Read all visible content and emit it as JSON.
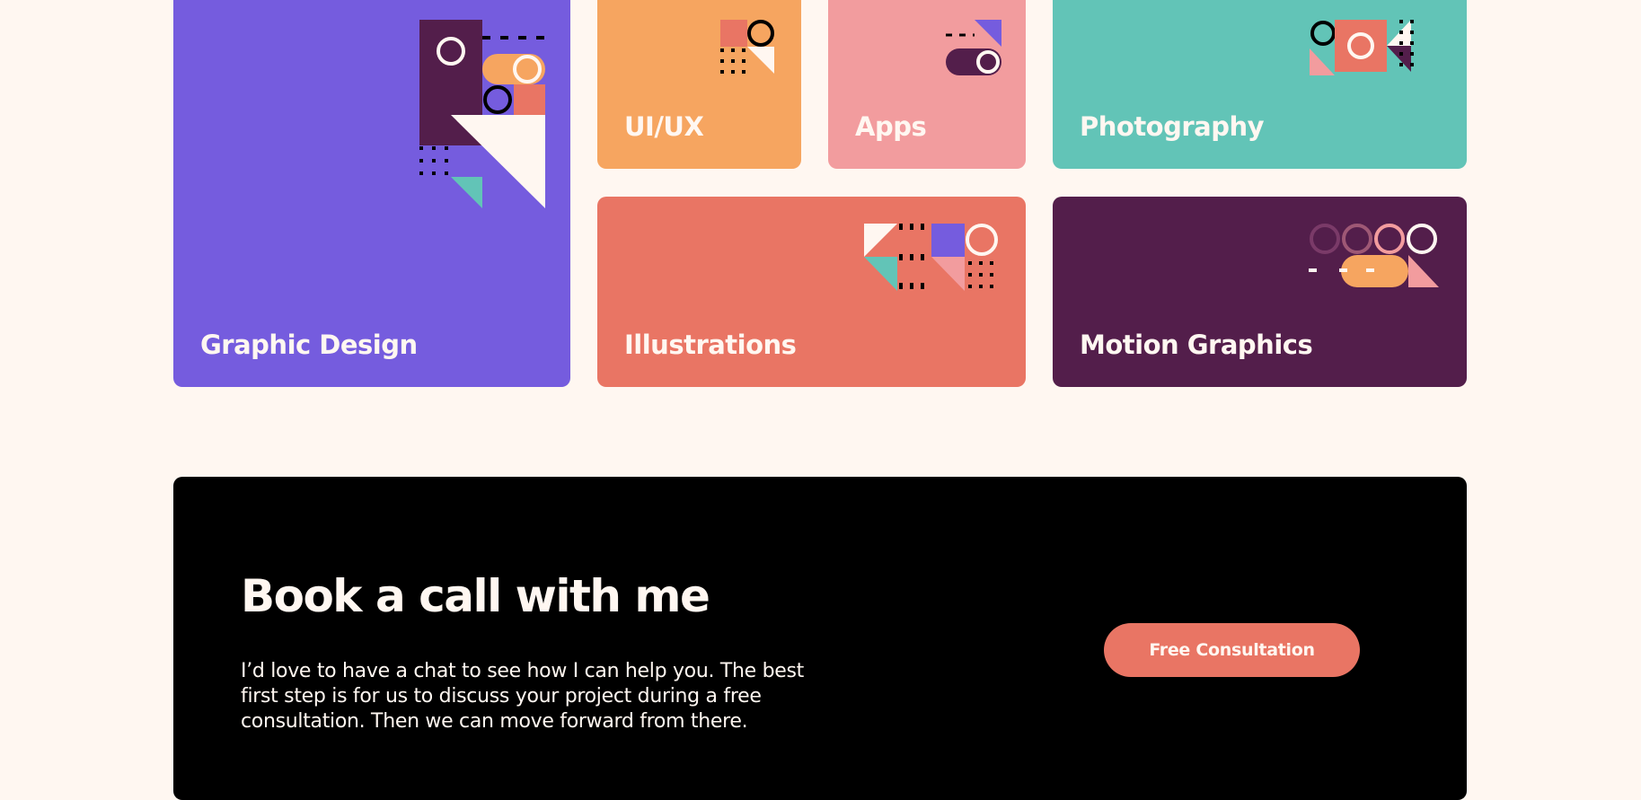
{
  "colors": {
    "background": "#FFF7F1",
    "purple": "#755CDE",
    "orange": "#F6A560",
    "pink": "#F29C9E",
    "teal": "#62C4B7",
    "coral": "#E97564",
    "plum": "#531E4B",
    "black": "#000000",
    "cream": "#FFF7F1"
  },
  "services": {
    "graphic_design": {
      "label": "Graphic Design",
      "icon": "graphic-design-pattern-icon"
    },
    "ui_ux": {
      "label": "UI/UX",
      "icon": "ui-ux-pattern-icon"
    },
    "apps": {
      "label": "Apps",
      "icon": "apps-pattern-icon"
    },
    "photography": {
      "label": "Photography",
      "icon": "photography-pattern-icon"
    },
    "illustrations": {
      "label": "Illustrations",
      "icon": "illustrations-pattern-icon"
    },
    "motion_graphics": {
      "label": "Motion Graphics",
      "icon": "motion-graphics-pattern-icon"
    }
  },
  "cta": {
    "title": "Book a call with me",
    "text": "I’d love to have a chat to see how I can help you. The best first step is for us to discuss your project during a free consultation. Then we can move forward from there.",
    "button_label": "Free Consultation"
  }
}
